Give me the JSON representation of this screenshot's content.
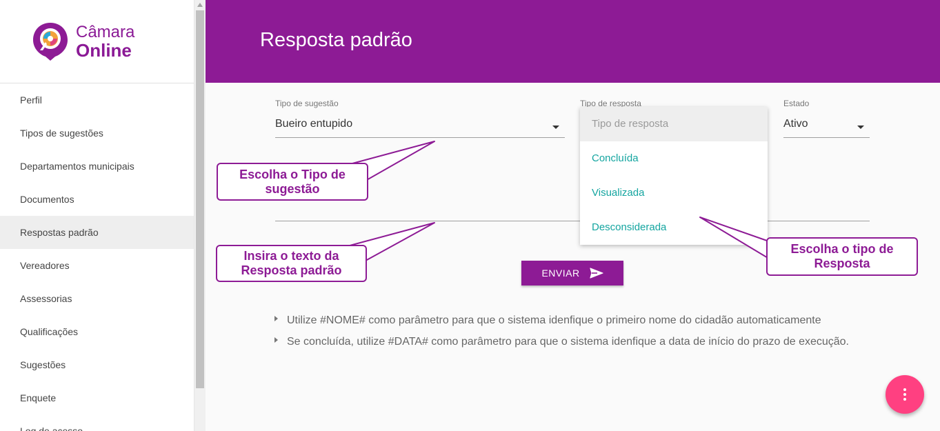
{
  "app": {
    "logo_line1": "Câmara",
    "logo_line2": "Online"
  },
  "sidebar": {
    "items": [
      {
        "label": "Perfil"
      },
      {
        "label": "Tipos de sugestões"
      },
      {
        "label": "Departamentos municipais"
      },
      {
        "label": "Documentos"
      },
      {
        "label": "Respostas padrão",
        "active": true
      },
      {
        "label": "Vereadores"
      },
      {
        "label": "Assessorias"
      },
      {
        "label": "Qualificações"
      },
      {
        "label": "Sugestões"
      },
      {
        "label": "Enquete"
      },
      {
        "label": "Log de acesso"
      }
    ]
  },
  "header": {
    "title": "Resposta padrão"
  },
  "form": {
    "tipo_sugestao": {
      "label": "Tipo de sugestão",
      "value": "Bueiro entupido"
    },
    "tipo_resposta": {
      "label": "Tipo de resposta",
      "placeholder": "Tipo de resposta",
      "options": [
        "Concluída",
        "Visualizada",
        "Desconsiderada"
      ]
    },
    "estado": {
      "label": "Estado",
      "value": "Ativo"
    },
    "submit_label": "ENVIAR"
  },
  "hints": [
    "Utilize #NOME# como parâmetro para que o sistema idenfique o primeiro nome do cidadão automaticamente",
    "Se concluída, utilize #DATA# como parâmetro para que o sistema idenfique a data de início do prazo de execução."
  ],
  "callouts": {
    "tipo_sugestao": "Escolha o Tipo de sugestão",
    "resposta_texto": "Insira o texto da Resposta padrão",
    "tipo_resposta": "Escolha o tipo de Resposta"
  },
  "colors": {
    "brand": "#8d1b95",
    "option_text": "#14a5a0",
    "fab": "#ff4081"
  },
  "icons": [
    "logo-icon",
    "dropdown-caret-icon",
    "send-icon",
    "more-vert-icon",
    "bullet-triangle-icon"
  ]
}
